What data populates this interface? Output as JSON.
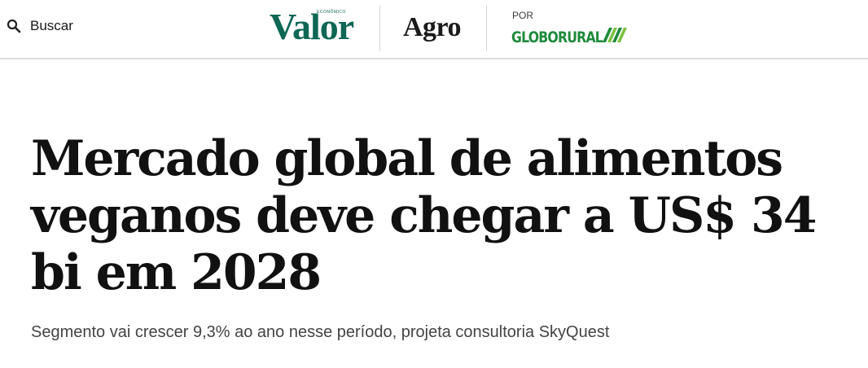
{
  "header": {
    "search_label": "Buscar",
    "brand_valor": "Valor",
    "brand_valor_sup": "ECONÔMICO",
    "brand_agro": "Agro",
    "por_label": "POR",
    "globo_rural": "GLOBORURAL",
    "colors": {
      "valor_green": "#0e6655",
      "globo_green": "#1f8a3b",
      "globo_light": "#7cc242"
    }
  },
  "article": {
    "headline": "Mercado global de alimentos veganos deve chegar a US$ 34 bi em 2028",
    "subtitle": "Segmento vai crescer 9,3% ao ano nesse período, projeta consultoria SkyQuest"
  }
}
